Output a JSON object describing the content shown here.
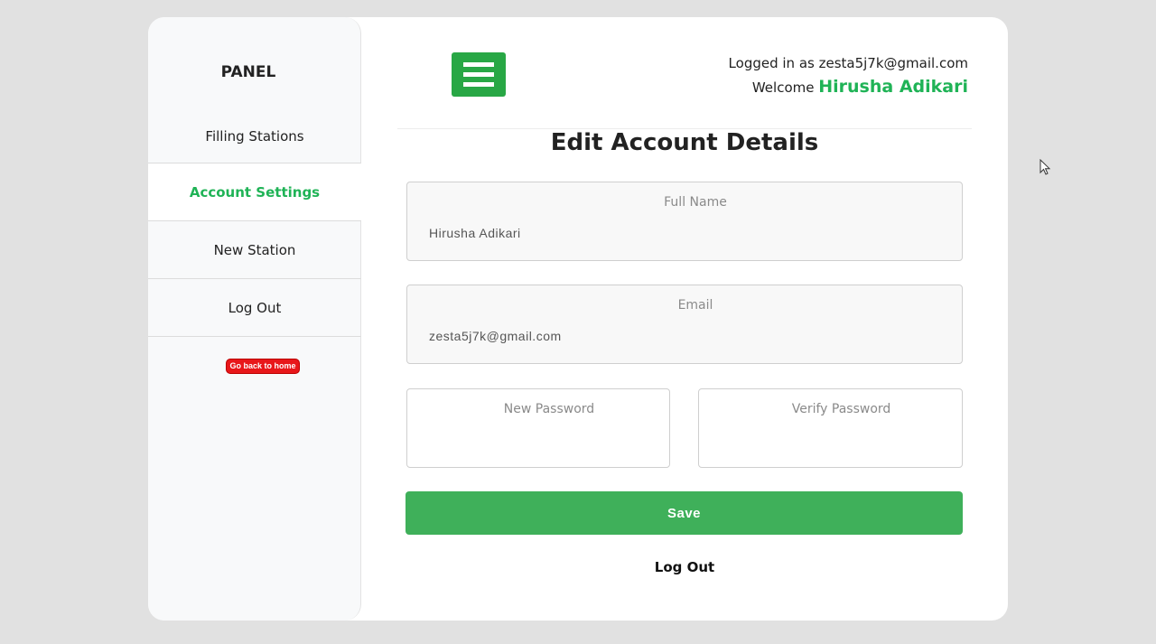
{
  "sidebar": {
    "title": "PANEL",
    "items": [
      {
        "label": "Filling Stations"
      },
      {
        "label": "Account Settings"
      },
      {
        "label": "New Station"
      },
      {
        "label": "Log Out"
      }
    ],
    "home_button": "Go back to home"
  },
  "header": {
    "logged_in_text": "Logged in as zesta5j7k@gmail.com",
    "welcome_text": "Welcome",
    "user_name": "Hirusha Adikari"
  },
  "form": {
    "title": "Edit Account Details",
    "full_name": {
      "label": "Full Name",
      "value": "Hirusha Adikari"
    },
    "email": {
      "label": "Email",
      "value": "zesta5j7k@gmail.com"
    },
    "new_password": {
      "label": "New Password",
      "value": ""
    },
    "verify_password": {
      "label": "Verify Password",
      "value": ""
    },
    "save_label": "Save",
    "logout_label": "Log Out"
  },
  "colors": {
    "accent": "#1fb356",
    "button": "#3fb05a",
    "danger": "#e8171a"
  }
}
